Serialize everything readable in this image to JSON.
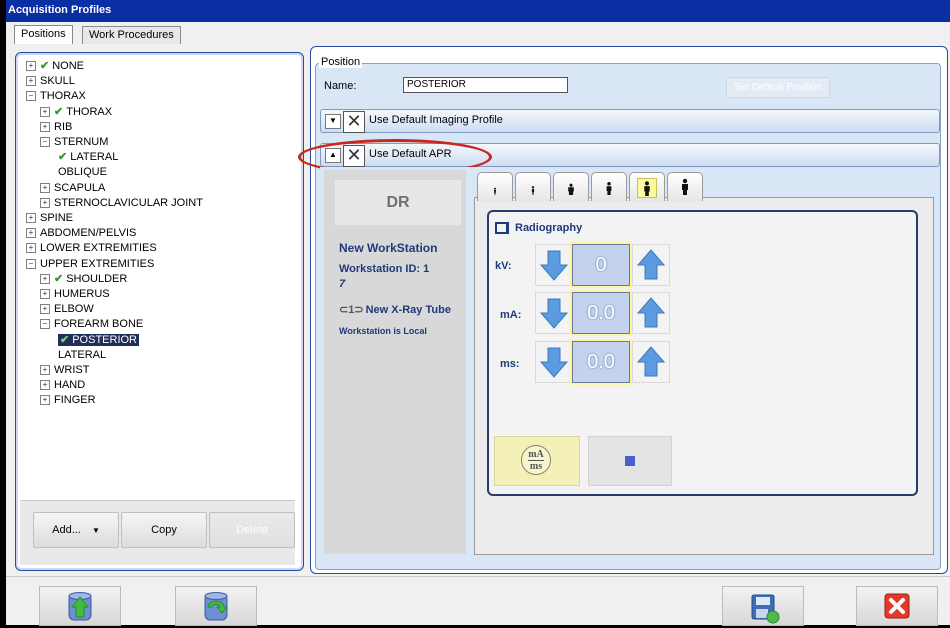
{
  "window": {
    "title": "Acquisition Profiles"
  },
  "tabs": [
    {
      "label": "Positions",
      "active": true
    },
    {
      "label": "Work Procedures",
      "active": false
    }
  ],
  "tree": [
    {
      "label": "NONE",
      "level": 0,
      "expander": "+",
      "check": true
    },
    {
      "label": "SKULL",
      "level": 0,
      "expander": "+",
      "check": false
    },
    {
      "label": "THORAX",
      "level": 0,
      "expander": "-",
      "check": false
    },
    {
      "label": "THORAX",
      "level": 1,
      "expander": "+",
      "check": true
    },
    {
      "label": "RIB",
      "level": 1,
      "expander": "+",
      "check": false
    },
    {
      "label": "STERNUM",
      "level": 1,
      "expander": "-",
      "check": false
    },
    {
      "label": "LATERAL",
      "level": 2,
      "expander": "",
      "check": true
    },
    {
      "label": "OBLIQUE",
      "level": 2,
      "expander": "",
      "check": false
    },
    {
      "label": "SCAPULA",
      "level": 1,
      "expander": "+",
      "check": false
    },
    {
      "label": "STERNOCLAVICULAR JOINT",
      "level": 1,
      "expander": "+",
      "check": false
    },
    {
      "label": "SPINE",
      "level": 0,
      "expander": "+",
      "check": false
    },
    {
      "label": "ABDOMEN/PELVIS",
      "level": 0,
      "expander": "+",
      "check": false
    },
    {
      "label": "LOWER EXTREMITIES",
      "level": 0,
      "expander": "+",
      "check": false
    },
    {
      "label": "UPPER EXTREMITIES",
      "level": 0,
      "expander": "-",
      "check": false
    },
    {
      "label": "SHOULDER",
      "level": 1,
      "expander": "+",
      "check": true
    },
    {
      "label": "HUMERUS",
      "level": 1,
      "expander": "+",
      "check": false
    },
    {
      "label": "ELBOW",
      "level": 1,
      "expander": "+",
      "check": false
    },
    {
      "label": "FOREARM BONE",
      "level": 1,
      "expander": "-",
      "check": false
    },
    {
      "label": "POSTERIOR",
      "level": 2,
      "expander": "",
      "check": true,
      "selected": true
    },
    {
      "label": "LATERAL",
      "level": 2,
      "expander": "",
      "check": false
    },
    {
      "label": "WRIST",
      "level": 1,
      "expander": "+",
      "check": false
    },
    {
      "label": "HAND",
      "level": 1,
      "expander": "+",
      "check": false
    },
    {
      "label": "FINGER",
      "level": 1,
      "expander": "+",
      "check": false
    }
  ],
  "tree_buttons": {
    "add": "Add...",
    "copy": "Copy",
    "delete": "Delete"
  },
  "position": {
    "group_label": "Position",
    "name_label": "Name:",
    "name_value": "POSTERIOR",
    "set_default": "Set Default Position",
    "imaging_profile_label": "Use Default Imaging Profile",
    "apr_label": "Use Default APR"
  },
  "workstation": {
    "dr_label": "DR",
    "name": "New WorkStation",
    "id_line": "Workstation ID:  1",
    "id_extra": "7",
    "tube": "New X-Ray Tube",
    "local": "Workstation is Local"
  },
  "radiography": {
    "title": "Radiography",
    "kv_label": "kV:",
    "kv_value": "0",
    "ma_label": "mA:",
    "ma_value": "0.0",
    "ms_label": "ms:",
    "ms_value": "0.0",
    "mams_icon_top": "mA",
    "mams_icon_bottom": "ms"
  },
  "colors": {
    "title_bar": "#0a2fa5",
    "annotation_oval": "#c7281e",
    "panel_border": "#2a4aa0",
    "value_box": "#c3d3ee",
    "arrow_blue": "#5b9be0",
    "check_green": "#2e9b2e"
  }
}
